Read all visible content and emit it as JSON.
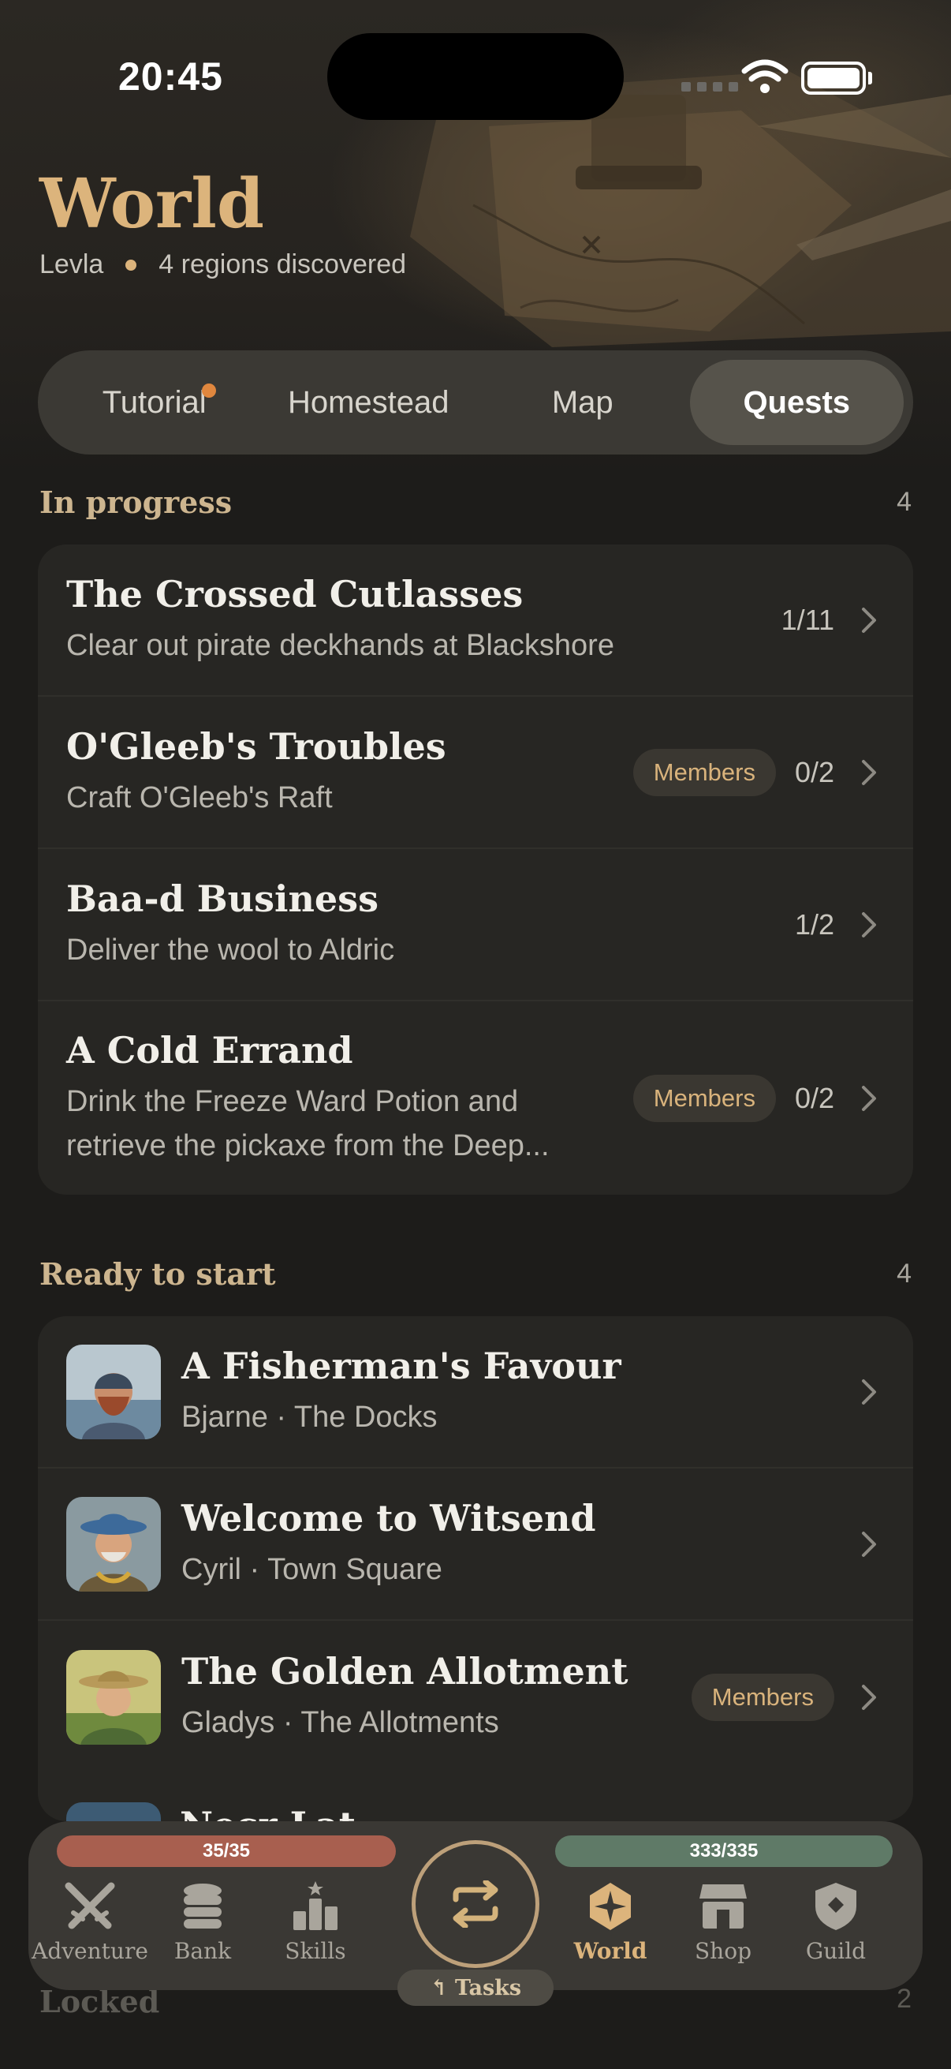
{
  "status": {
    "time": "20:45"
  },
  "header": {
    "title": "World",
    "player": "Levla",
    "regions": "4 regions discovered"
  },
  "tabs": [
    {
      "label": "Tutorial",
      "has_dot": true
    },
    {
      "label": "Homestead"
    },
    {
      "label": "Map"
    },
    {
      "label": "Quests",
      "active": true
    }
  ],
  "in_progress": {
    "label": "In progress",
    "count": "4",
    "items": [
      {
        "title": "The Crossed Cutlasses",
        "desc": "Clear out pirate deckhands at Blackshore",
        "badge": "",
        "progress": "1/11"
      },
      {
        "title": "O'Gleeb's Troubles",
        "desc": "Craft O'Gleeb's Raft",
        "badge": "Members",
        "progress": "0/2"
      },
      {
        "title": "Baa-d Business",
        "desc": "Deliver the wool to Aldric",
        "badge": "",
        "progress": "1/2"
      },
      {
        "title": "A Cold Errand",
        "desc": "Drink the Freeze Ward Potion and retrieve the pickaxe from the Deep...",
        "badge": "Members",
        "progress": "0/2"
      }
    ]
  },
  "ready": {
    "label": "Ready to start",
    "count": "4",
    "items": [
      {
        "title": "A Fisherman's Favour",
        "desc": "Bjarne · The Docks",
        "badge": "",
        "avatar": "fisherman-portrait"
      },
      {
        "title": "Welcome to Witsend",
        "desc": "Cyril · Town Square",
        "badge": "",
        "avatar": "mayor-portrait"
      },
      {
        "title": "The Golden Allotment",
        "desc": "Gladys · The Allotments",
        "badge": "Members",
        "avatar": "farmer-portrait"
      }
    ],
    "partial_title": "Necr Lat"
  },
  "locked": {
    "label": "Locked",
    "count": "2"
  },
  "nav": {
    "hp": "35/35",
    "energy": "333/335",
    "items": [
      {
        "label": "Adventure",
        "icon": "crossed-swords-icon"
      },
      {
        "label": "Bank",
        "icon": "coin-stack-icon"
      },
      {
        "label": "Skills",
        "icon": "podium-icon"
      },
      {
        "label": "World",
        "icon": "compass-star-icon",
        "active": true
      },
      {
        "label": "Shop",
        "icon": "storefront-icon"
      },
      {
        "label": "Guild",
        "icon": "shield-icon"
      }
    ],
    "tasks": "↰ Tasks",
    "center_icon": "repeat-arrows-icon"
  },
  "colors": {
    "accent": "#dcb47c",
    "hp": "#a85f4f",
    "energy": "#5f7a67",
    "badge_dot": "#e0873e"
  }
}
